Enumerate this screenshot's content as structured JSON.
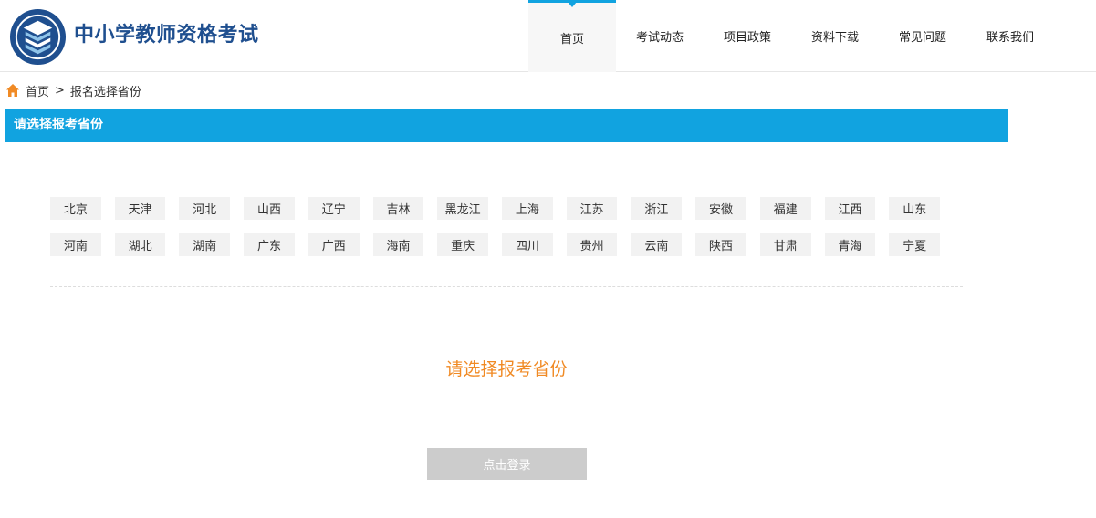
{
  "header": {
    "title": "中小学教师资格考试",
    "nav": [
      {
        "label": "首页",
        "active": true
      },
      {
        "label": "考试动态"
      },
      {
        "label": "项目政策"
      },
      {
        "label": "资料下载"
      },
      {
        "label": "常见问题"
      },
      {
        "label": "联系我们"
      }
    ]
  },
  "breadcrumb": {
    "home": "首页",
    "separator": ">",
    "current": "报名选择省份"
  },
  "panel": {
    "title": "请选择报考省份"
  },
  "provinces": {
    "row1": [
      "北京",
      "天津",
      "河北",
      "山西",
      "辽宁",
      "吉林",
      "黑龙江",
      "上海",
      "江苏",
      "浙江",
      "安徽",
      "福建",
      "江西",
      "山东"
    ],
    "row2": [
      "河南",
      "湖北",
      "湖南",
      "广东",
      "广西",
      "海南",
      "重庆",
      "四川",
      "贵州",
      "云南",
      "陕西",
      "甘肃",
      "青海",
      "宁夏"
    ]
  },
  "prompt": "请选择报考省份",
  "login_button": "点击登录",
  "colors": {
    "accent": "#11a3e0",
    "title": "#1f4f8f",
    "prompt": "#f08a24",
    "home_icon": "#f08a24",
    "button_disabled": "#cccccc"
  }
}
